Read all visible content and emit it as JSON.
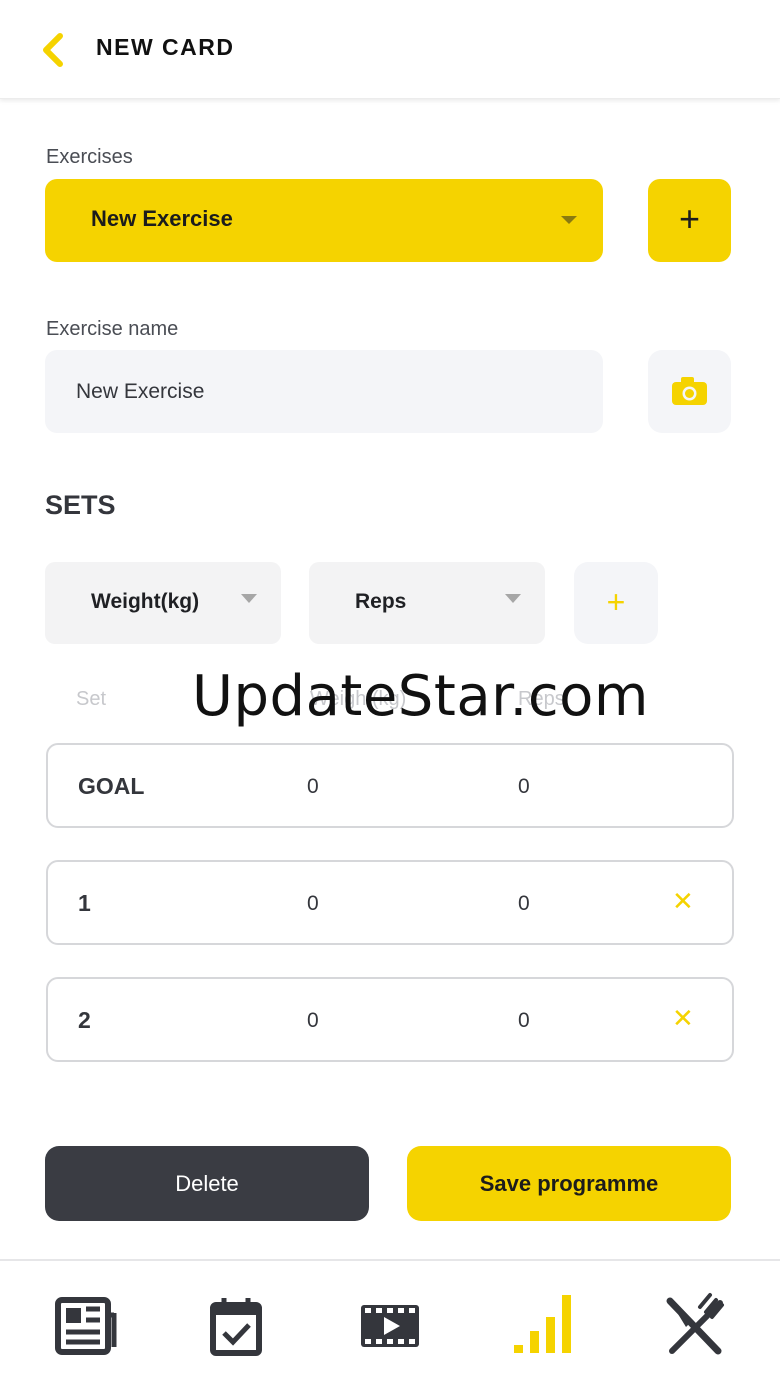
{
  "header": {
    "title": "NEW CARD",
    "back_icon": "chevron-left-icon"
  },
  "exercises": {
    "label": "Exercises",
    "selected": "New Exercise"
  },
  "exercise_name": {
    "label": "Exercise name",
    "value": "New Exercise"
  },
  "sets": {
    "title": "SETS",
    "column_selectors": [
      "Weight(kg)",
      "Reps"
    ],
    "headers": {
      "set": "Set",
      "weight": "Weight(kg)",
      "reps": "Reps"
    },
    "rows": [
      {
        "set": "GOAL",
        "weight": "0",
        "reps": "0",
        "removable": false
      },
      {
        "set": "1",
        "weight": "0",
        "reps": "0",
        "removable": true
      },
      {
        "set": "2",
        "weight": "0",
        "reps": "0",
        "removable": true
      }
    ]
  },
  "watermark": "UpdateStar.com",
  "actions": {
    "delete": "Delete",
    "save": "Save programme"
  },
  "tabbar": [
    {
      "icon": "news-icon",
      "active": false
    },
    {
      "icon": "calendar-check-icon",
      "active": false
    },
    {
      "icon": "video-icon",
      "active": false
    },
    {
      "icon": "stats-bars-icon",
      "active": true
    },
    {
      "icon": "fork-knife-icon",
      "active": false
    }
  ],
  "colors": {
    "accent": "#f5d300",
    "dark": "#3a3c43",
    "field_bg": "#f4f5f8"
  }
}
